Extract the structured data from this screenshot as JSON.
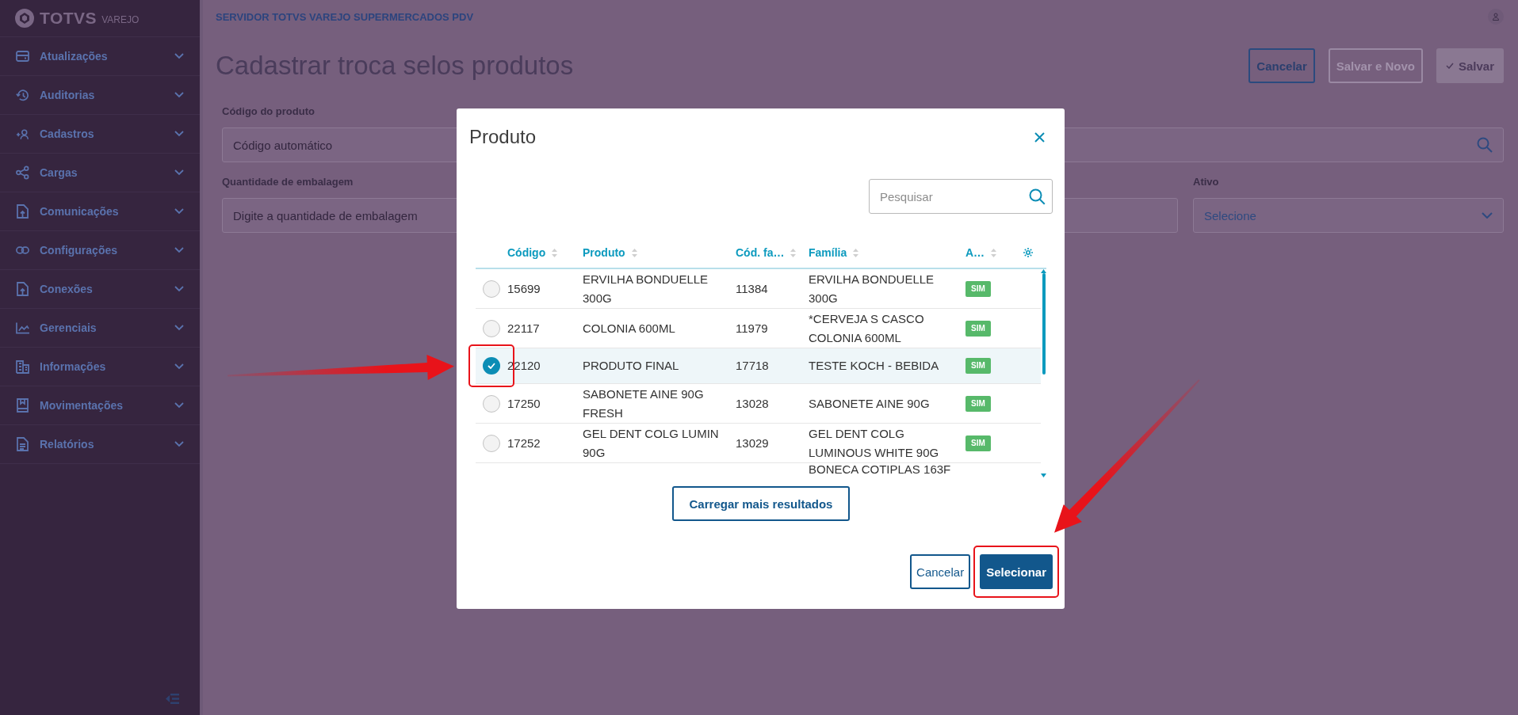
{
  "sidebar": {
    "logo": {
      "brand": "TOTVS",
      "product": "VAREJO"
    },
    "items": [
      {
        "label": "Atualizações"
      },
      {
        "label": "Auditorias"
      },
      {
        "label": "Cadastros"
      },
      {
        "label": "Cargas"
      },
      {
        "label": "Comunicações"
      },
      {
        "label": "Configurações"
      },
      {
        "label": "Conexões"
      },
      {
        "label": "Gerenciais"
      },
      {
        "label": "Informações"
      },
      {
        "label": "Movimentações"
      },
      {
        "label": "Relatórios"
      }
    ]
  },
  "header": {
    "server": "SERVIDOR TOTVS VAREJO SUPERMERCADOS PDV"
  },
  "page": {
    "title": "Cadastrar troca selos produtos",
    "actions": [
      {
        "label": "Cancelar",
        "kind": "secondary",
        "disabled": false
      },
      {
        "label": "Salvar e Novo",
        "kind": "secondary",
        "disabled": true
      },
      {
        "label": "Salvar",
        "kind": "primary",
        "disabled": true
      }
    ],
    "fields": [
      {
        "label": "Código do produto",
        "placeholder": "Código automático",
        "kind": "search"
      },
      {
        "label": "Quantidade de embalagem",
        "placeholder": "Digite a quantidade de embalagem",
        "kind": "text"
      },
      {
        "kind": "text"
      },
      {
        "label": "Ativo",
        "value": "Selecione",
        "kind": "select"
      }
    ]
  },
  "dialog": {
    "title": "Produto",
    "search": {
      "placeholder": "Pesquisar"
    },
    "table": {
      "columns": [
        "Código",
        "Produto",
        "Cód. fa…",
        "Família",
        "A…"
      ],
      "rows": [
        {
          "selected": false,
          "codigo": "15699",
          "produto": "ERVILHA BONDUELLE 300G",
          "cod_familia": "11384",
          "familia": "ERVILHA BONDUELLE 300G",
          "ativo": "SIM"
        },
        {
          "selected": false,
          "codigo": "22117",
          "produto": "COLONIA 600ML",
          "cod_familia": "11979",
          "familia": "*CERVEJA S CASCO COLONIA 600ML",
          "ativo": "SIM"
        },
        {
          "selected": true,
          "highlighted": true,
          "codigo": "22120",
          "produto": "PRODUTO FINAL",
          "cod_familia": "17718",
          "familia": "TESTE KOCH - BEBIDA",
          "ativo": "SIM"
        },
        {
          "selected": false,
          "codigo": "17250",
          "produto": "SABONETE AINE 90G FRESH",
          "cod_familia": "13028",
          "familia": "SABONETE AINE 90G",
          "ativo": "SIM"
        },
        {
          "selected": false,
          "codigo": "17252",
          "produto": "GEL DENT COLG LUMIN 90G",
          "cod_familia": "13029",
          "familia": "GEL DENT COLG LUMINOUS WHITE 90G",
          "ativo": "SIM"
        },
        {
          "familia": "BONECA COTIPLAS 163F"
        }
      ]
    },
    "load_more": "Carregar mais resultados",
    "buttons": [
      {
        "label": "Cancelar",
        "kind": "secondary"
      },
      {
        "label": "Selecionar",
        "kind": "primary",
        "highlighted": true
      }
    ]
  }
}
